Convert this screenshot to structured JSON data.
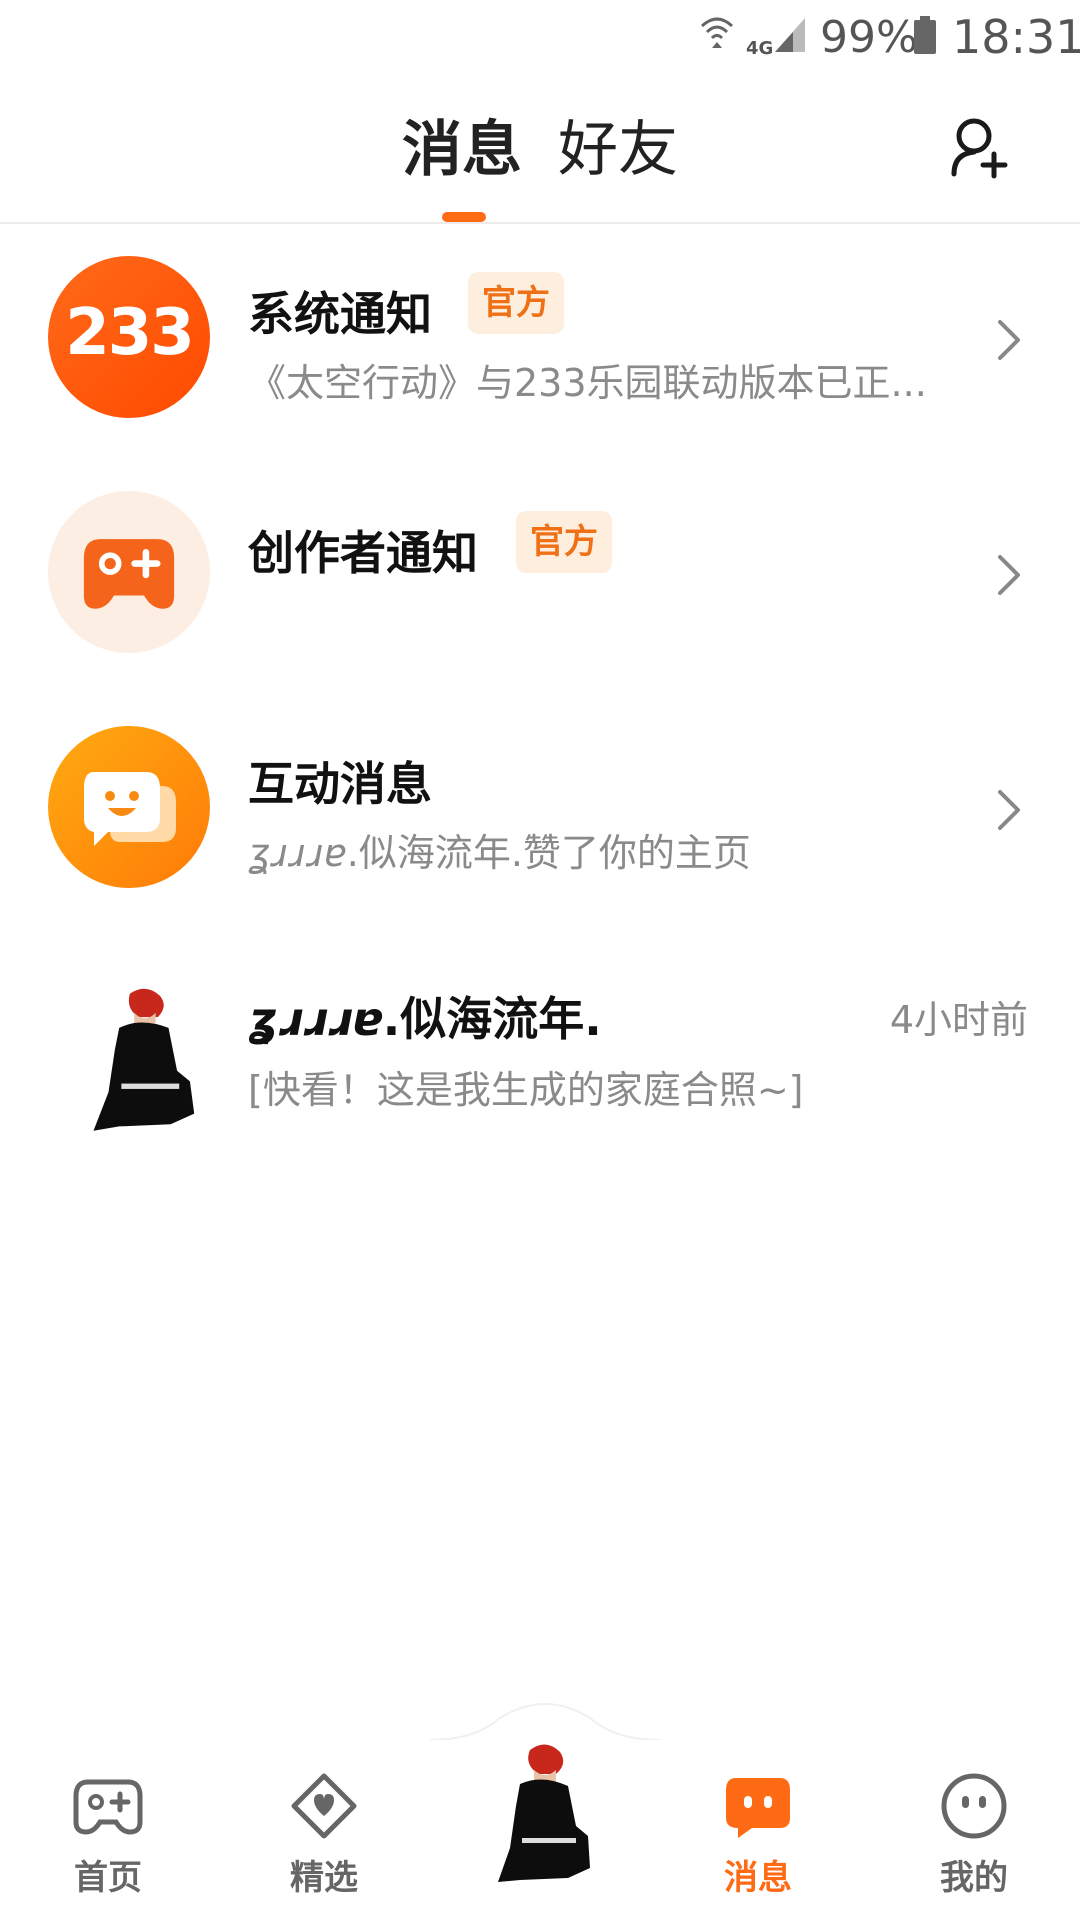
{
  "status_bar": {
    "network": "4G",
    "battery": "99%",
    "time": "18:31"
  },
  "header": {
    "tabs": [
      {
        "label": "消息",
        "active": true
      },
      {
        "label": "好友",
        "active": false
      }
    ]
  },
  "messages": [
    {
      "title": "系统通知",
      "badge": "官方",
      "avatar_text": "233",
      "subtitle": "《太空行动》与233乐园联动版本已正..."
    },
    {
      "title": "创作者通知",
      "badge": "官方",
      "subtitle": ""
    },
    {
      "title": "互动消息",
      "subtitle_name": "ʓɹɹɹɐ",
      "subtitle": ".似海流年.赞了你的主页"
    },
    {
      "title_name": "ʓɹɹɹɐ",
      "title": ".似海流年.",
      "time": "4小时前",
      "subtitle": "[快看！这是我生成的家庭合照~]"
    }
  ],
  "bottom_nav": [
    {
      "label": "首页",
      "icon": "gamepad-icon",
      "active": false
    },
    {
      "label": "精选",
      "icon": "heart-box-icon",
      "active": false
    },
    {
      "label": "",
      "icon": "avatar",
      "active": false
    },
    {
      "label": "消息",
      "icon": "chat-icon",
      "active": true
    },
    {
      "label": "我的",
      "icon": "face-icon",
      "active": false
    }
  ],
  "colors": {
    "accent": "#ff6a14",
    "badge_bg": "#fdeede",
    "text_sub": "#8a8a8a"
  }
}
